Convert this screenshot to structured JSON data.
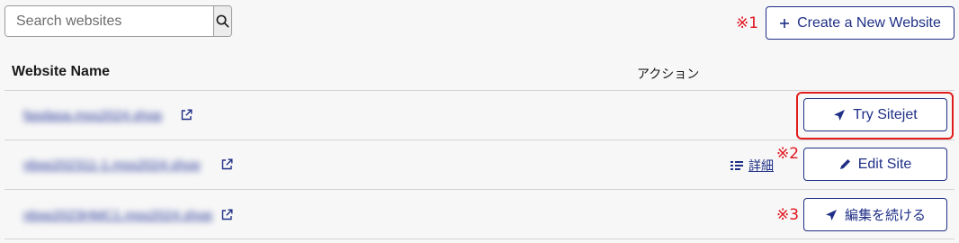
{
  "search": {
    "placeholder": "Search websites",
    "icon": "search-icon"
  },
  "notes": {
    "n1": "※1",
    "n2": "※2",
    "n3": "※3"
  },
  "create_button": {
    "label": "Create a New Website",
    "icon": "plus-icon"
  },
  "table": {
    "col_name": "Website Name",
    "col_action": "アクション",
    "rows": [
      {
        "url": "fasdasa.mss2024.shop",
        "action_label": "Try Sitejet",
        "action_icon": "send-icon"
      },
      {
        "url": "nbsp202311-1.mss2024.shop",
        "action_label": "Edit Site",
        "action_icon": "pencil-icon",
        "detail_label": "詳細"
      },
      {
        "url": "nbsp2023HMC1.mss2024.shop",
        "action_label": "編集を続ける",
        "action_icon": "send-icon"
      }
    ]
  },
  "colors": {
    "brand": "#1f2f86",
    "note_red": "#e0141e",
    "highlight": "#e01c1c"
  }
}
